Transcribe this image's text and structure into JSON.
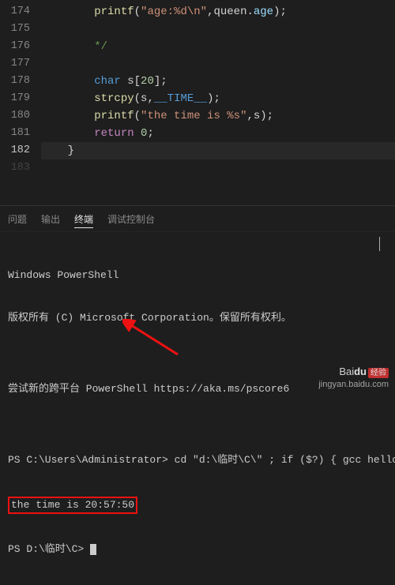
{
  "editor": {
    "lines": [
      {
        "num": "174",
        "indent": "        ",
        "tokens": [
          {
            "cls": "cfunc",
            "t": "printf"
          },
          {
            "cls": "cpunct",
            "t": "("
          },
          {
            "cls": "cstr",
            "t": "\"age:%d\\n\""
          },
          {
            "cls": "cpunct",
            "t": ",queen."
          },
          {
            "cls": "cvar",
            "t": "age"
          },
          {
            "cls": "cpunct",
            "t": ");"
          }
        ]
      },
      {
        "num": "175",
        "indent": "",
        "tokens": []
      },
      {
        "num": "176",
        "indent": "        ",
        "tokens": [
          {
            "cls": "cgreen",
            "t": "*/"
          }
        ]
      },
      {
        "num": "177",
        "indent": "",
        "tokens": []
      },
      {
        "num": "178",
        "indent": "        ",
        "tokens": [
          {
            "cls": "ctype",
            "t": "char"
          },
          {
            "cls": "cpunct",
            "t": " s["
          },
          {
            "cls": "cnum",
            "t": "20"
          },
          {
            "cls": "cpunct",
            "t": "];"
          }
        ]
      },
      {
        "num": "179",
        "indent": "        ",
        "tokens": [
          {
            "cls": "cfunc",
            "t": "strcpy"
          },
          {
            "cls": "cpunct",
            "t": "(s,"
          },
          {
            "cls": "cmacro",
            "t": "__TIME__"
          },
          {
            "cls": "cpunct",
            "t": ");"
          }
        ]
      },
      {
        "num": "180",
        "indent": "        ",
        "tokens": [
          {
            "cls": "cfunc",
            "t": "printf"
          },
          {
            "cls": "cpunct",
            "t": "("
          },
          {
            "cls": "cstr",
            "t": "\"the time is %s\""
          },
          {
            "cls": "cpunct",
            "t": ",s);"
          }
        ]
      },
      {
        "num": "181",
        "indent": "        ",
        "tokens": [
          {
            "cls": "ckey",
            "t": "return"
          },
          {
            "cls": "cpunct",
            "t": " "
          },
          {
            "cls": "cnum",
            "t": "0"
          },
          {
            "cls": "cpunct",
            "t": ";"
          }
        ]
      },
      {
        "num": "182",
        "indent": "    ",
        "tokens": [
          {
            "cls": "cpunct",
            "t": "}"
          }
        ],
        "current": true
      }
    ],
    "extra_num": "183"
  },
  "panel": {
    "tabs": [
      "问题",
      "输出",
      "终端",
      "调试控制台"
    ],
    "active_index": 2
  },
  "terminal": {
    "banner1": "Windows PowerShell",
    "banner2": "版权所有 (C) Microsoft Corporation。保留所有权利。",
    "blank1": "",
    "tip": "尝试新的跨平台 PowerShell https://aka.ms/pscore6",
    "blank2": "",
    "prompt1_path": "PS C:\\Users\\Administrator>",
    "prompt1_cmd": " cd \"d:\\临时\\C\\\" ; if ($?) { gcc hello.c -",
    "output_highlight": "the time is 20:57:50",
    "prompt2_path": "PS D:\\临时\\C>",
    "prompt2_cmd": " "
  },
  "watermark": {
    "brand_prefix": "Bai",
    "brand_bold": "du",
    "brand_badge": "经验",
    "url": "jingyan.baidu.com"
  }
}
